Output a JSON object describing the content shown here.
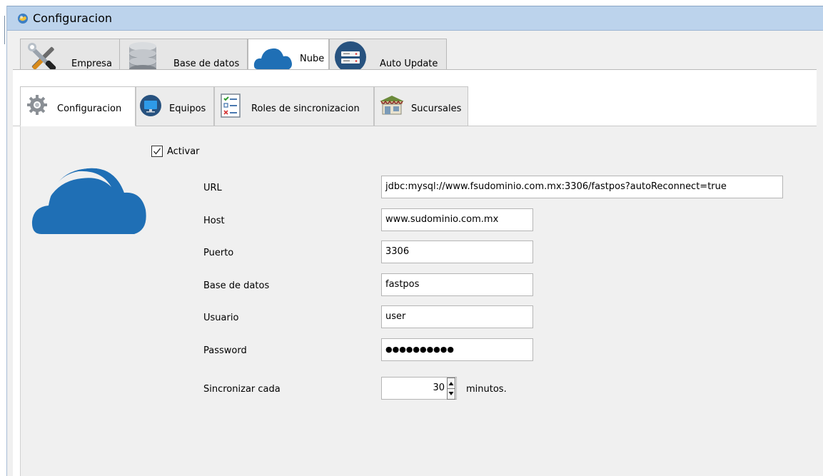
{
  "window": {
    "title": "Configuracion"
  },
  "top_tabs": [
    {
      "label": "Empresa",
      "icon": "tools-icon"
    },
    {
      "label": "Base de datos",
      "icon": "database-icon"
    },
    {
      "label": "Nube",
      "icon": "cloud-icon",
      "active": true
    },
    {
      "label": "Auto Update",
      "icon": "server-icon"
    }
  ],
  "sub_tabs": [
    {
      "label": "Configuracion",
      "icon": "gear-icon",
      "active": true
    },
    {
      "label": "Equipos",
      "icon": "monitor-icon"
    },
    {
      "label": "Roles de sincronizacion",
      "icon": "checklist-icon"
    },
    {
      "label": "Sucursales",
      "icon": "store-icon"
    }
  ],
  "form": {
    "activar_label": "Activar",
    "activar_checked": true,
    "url_label": "URL",
    "url_value": "jdbc:mysql://www.fsudominio.com.mx:3306/fastpos?autoReconnect=true",
    "host_label": "Host",
    "host_value": "www.sudominio.com.mx",
    "puerto_label": "Puerto",
    "puerto_value": "3306",
    "bd_label": "Base de datos",
    "bd_value": "fastpos",
    "usuario_label": "Usuario",
    "usuario_value": "user",
    "password_label": "Password",
    "password_value": "●●●●●●●●●●",
    "sync_label": "Sincronizar cada",
    "sync_value": "30",
    "sync_unit": "minutos."
  },
  "colors": {
    "accent": "#1f6fb5",
    "titlebar": "#bcd3ec"
  }
}
